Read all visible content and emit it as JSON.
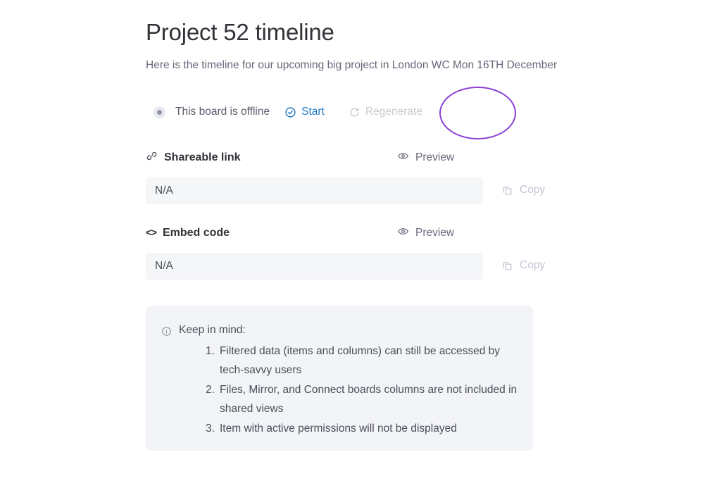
{
  "header": {
    "title": "Project 52 timeline",
    "subtitle": "Here is the timeline for our upcoming big project in London WC Mon 16TH December"
  },
  "status_row": {
    "toggle_icon": "radio-filled-icon",
    "status_label": "This board is offline",
    "start": {
      "label": "Start",
      "icon": "check-circle-icon",
      "color": "#1f76c2"
    },
    "regenerate": {
      "label": "Regenerate",
      "icon": "refresh-icon",
      "color": "#c9cbd3"
    }
  },
  "annotation": {
    "shape": "ellipse-highlight",
    "color": "#8b3fd4",
    "targets": "Start"
  },
  "shareable_link": {
    "label": "Shareable link",
    "label_icon": "link-icon",
    "preview_label": "Preview",
    "preview_icon": "eye-icon",
    "value": "N/A",
    "placeholder": "N/A",
    "copy_label": "Copy",
    "copy_icon": "copy-icon"
  },
  "embed_code": {
    "label": "Embed code",
    "label_icon": "code-icon",
    "label_icon_glyph": "<>",
    "preview_label": "Preview",
    "preview_icon": "eye-icon",
    "value": "N/A",
    "placeholder": "N/A",
    "copy_label": "Copy",
    "copy_icon": "copy-icon"
  },
  "info_panel": {
    "icon": "info-circle-icon",
    "title": "Keep in mind:",
    "items": [
      "Filtered data (items and columns) can still be accessed by tech-savvy users",
      "Files, Mirror, and Connect boards columns are not included in shared views",
      "Item with active permissions will not be displayed"
    ]
  }
}
